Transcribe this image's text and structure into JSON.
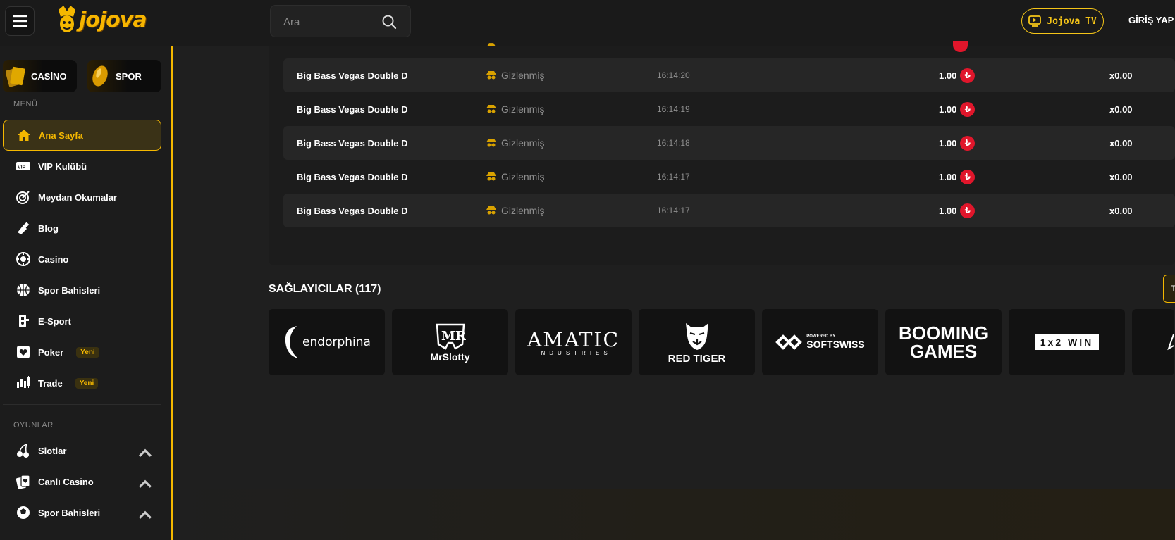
{
  "header": {
    "logo_text": "jojova",
    "search_placeholder": "Ara",
    "tv_label": "Jojova TV",
    "login_label": "GİRİŞ YAP"
  },
  "sidebar": {
    "tiles": [
      {
        "label": "CASİNO"
      },
      {
        "label": "SPOR"
      }
    ],
    "menu_title": "MENÜ",
    "menu": [
      {
        "label": "Ana Sayfa",
        "icon": "home-icon",
        "active": true
      },
      {
        "label": "VIP Kulübü",
        "icon": "vip-icon"
      },
      {
        "label": "Meydan Okumalar",
        "icon": "target-icon"
      },
      {
        "label": "Blog",
        "icon": "pen-icon"
      },
      {
        "label": "Casino",
        "icon": "chip-icon"
      },
      {
        "label": "Spor Bahisleri",
        "icon": "basketball-icon"
      },
      {
        "label": "E-Sport",
        "icon": "controller-icon"
      },
      {
        "label": "Poker",
        "icon": "card-icon",
        "badge": "Yeni"
      },
      {
        "label": "Trade",
        "icon": "candles-icon",
        "badge": "Yeni"
      }
    ],
    "games_title": "OYUNLAR",
    "games": [
      {
        "label": "Slotlar",
        "icon": "cherry-icon"
      },
      {
        "label": "Canlı Casino",
        "icon": "cards-icon"
      },
      {
        "label": "Spor Bahisleri",
        "icon": "sport-icon"
      }
    ]
  },
  "bets": {
    "rows": [
      {
        "game": "Big Bass Vegas Double D",
        "user": "Gizlenmiş",
        "time": "16:14:20",
        "amount": "1.00",
        "currency": "₺",
        "multiplier": "x0.00"
      },
      {
        "game": "Big Bass Vegas Double D",
        "user": "Gizlenmiş",
        "time": "16:14:19",
        "amount": "1.00",
        "currency": "₺",
        "multiplier": "x0.00"
      },
      {
        "game": "Big Bass Vegas Double D",
        "user": "Gizlenmiş",
        "time": "16:14:18",
        "amount": "1.00",
        "currency": "₺",
        "multiplier": "x0.00"
      },
      {
        "game": "Big Bass Vegas Double D",
        "user": "Gizlenmiş",
        "time": "16:14:17",
        "amount": "1.00",
        "currency": "₺",
        "multiplier": "x0.00"
      },
      {
        "game": "Big Bass Vegas Double D",
        "user": "Gizlenmiş",
        "time": "16:14:17",
        "amount": "1.00",
        "currency": "₺",
        "multiplier": "x0.00"
      }
    ]
  },
  "providers": {
    "title": "SAĞLAYICILAR (117)",
    "nav_label": "T",
    "items": [
      {
        "name": "endorphina"
      },
      {
        "name": "MrSlotty"
      },
      {
        "name": "AMATIC",
        "sub": "INDUSTRIES"
      },
      {
        "name": "RED TIGER"
      },
      {
        "name": "SOFTSWISS",
        "sub": "POWERED BY"
      },
      {
        "name": "BOOMING",
        "sub": "GAMES"
      },
      {
        "name": "1x2 WIN"
      }
    ]
  },
  "colors": {
    "accent": "#f5b800",
    "background": "#1f1f1f",
    "coin": "#e0162b"
  }
}
